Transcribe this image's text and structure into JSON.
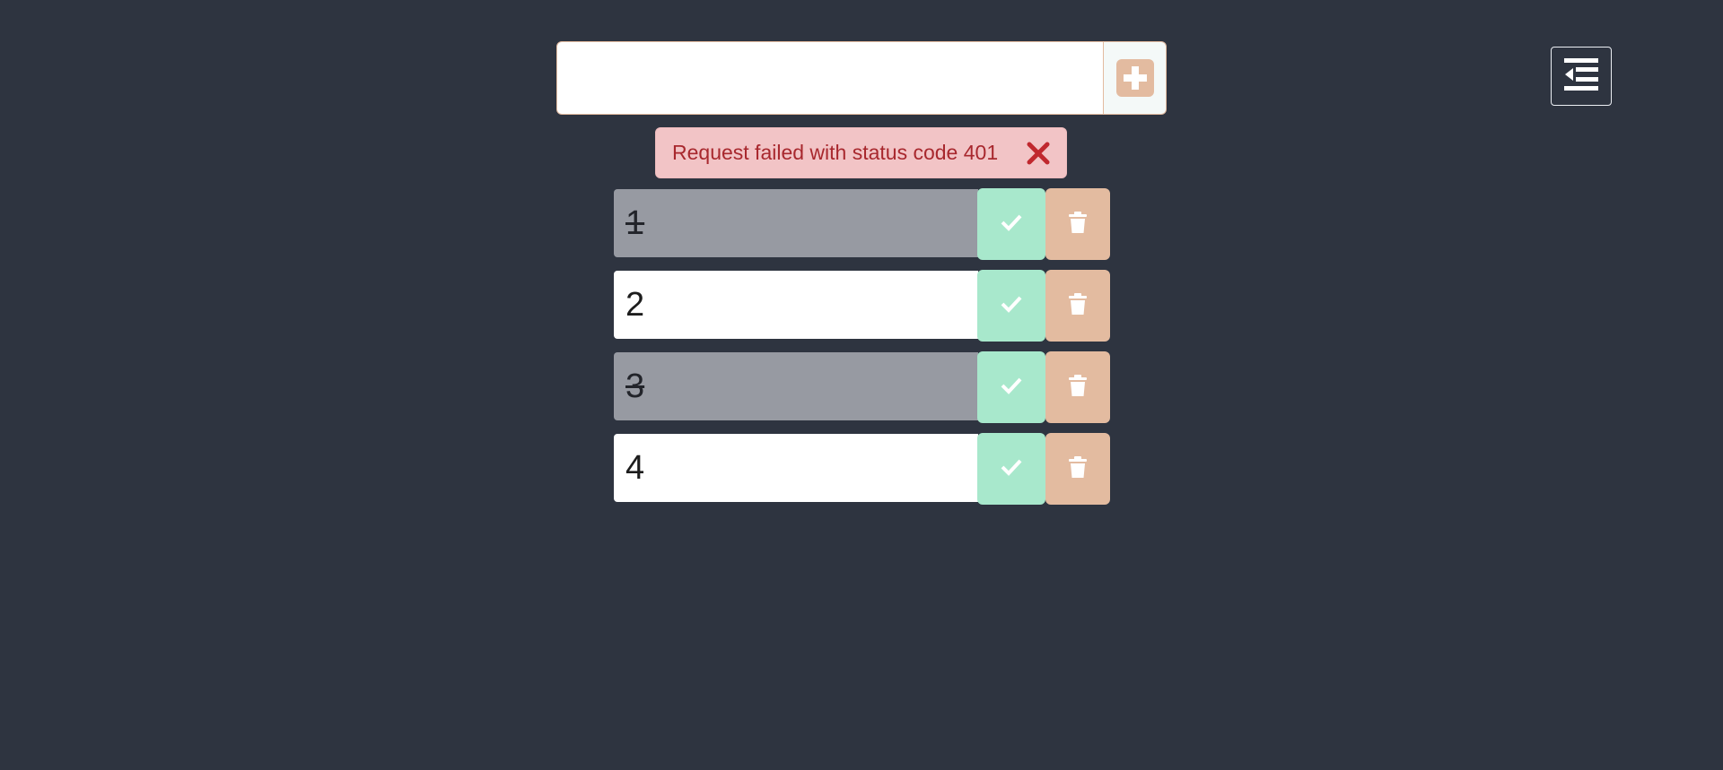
{
  "colors": {
    "background": "#2e3440",
    "accent_peach": "#e3bba0",
    "complete_green": "#a8e8cc",
    "done_gray": "#979aa2",
    "alert_bg": "#f2c4c6",
    "alert_text": "#a8282e"
  },
  "add_bar": {
    "input_value": "",
    "input_placeholder": "",
    "button_icon": "plus-square-icon"
  },
  "menu_toggle": {
    "icon": "indent-left-icon"
  },
  "alert": {
    "message": "Request failed with status code 401",
    "close_icon": "close-x-icon"
  },
  "todos": [
    {
      "text": "1",
      "done": true
    },
    {
      "text": "2",
      "done": false
    },
    {
      "text": "3",
      "done": true
    },
    {
      "text": "4",
      "done": false
    }
  ],
  "item_actions": {
    "complete_icon": "checkmark-icon",
    "delete_icon": "trash-icon"
  }
}
